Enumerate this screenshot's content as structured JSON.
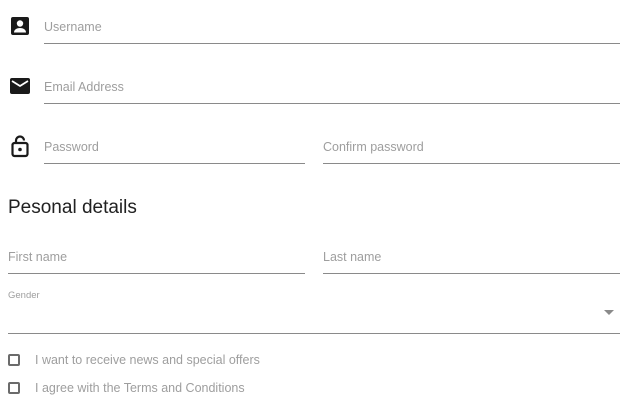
{
  "account": {
    "username_placeholder": "Username",
    "email_placeholder": "Email Address",
    "password_placeholder": "Password",
    "confirm_password_placeholder": "Confirm password"
  },
  "personal": {
    "title": "Pesonal details",
    "first_name_placeholder": "First name",
    "last_name_placeholder": "Last name",
    "gender_label": "Gender",
    "gender_value": ""
  },
  "checkboxes": {
    "news": {
      "label": "I want to receive news and special offers",
      "checked": false
    },
    "terms": {
      "label": "I agree with the Terms and Conditions",
      "checked": false
    }
  },
  "icons": {
    "username": "account-box-icon",
    "email": "email-icon",
    "password": "lock-open-icon",
    "gender_dropdown": "dropdown-arrow-icon"
  },
  "colors": {
    "text": "#212121",
    "placeholder": "#9e9e9e",
    "underline": "#8a8a8a",
    "icon": "#1a1a1a"
  }
}
